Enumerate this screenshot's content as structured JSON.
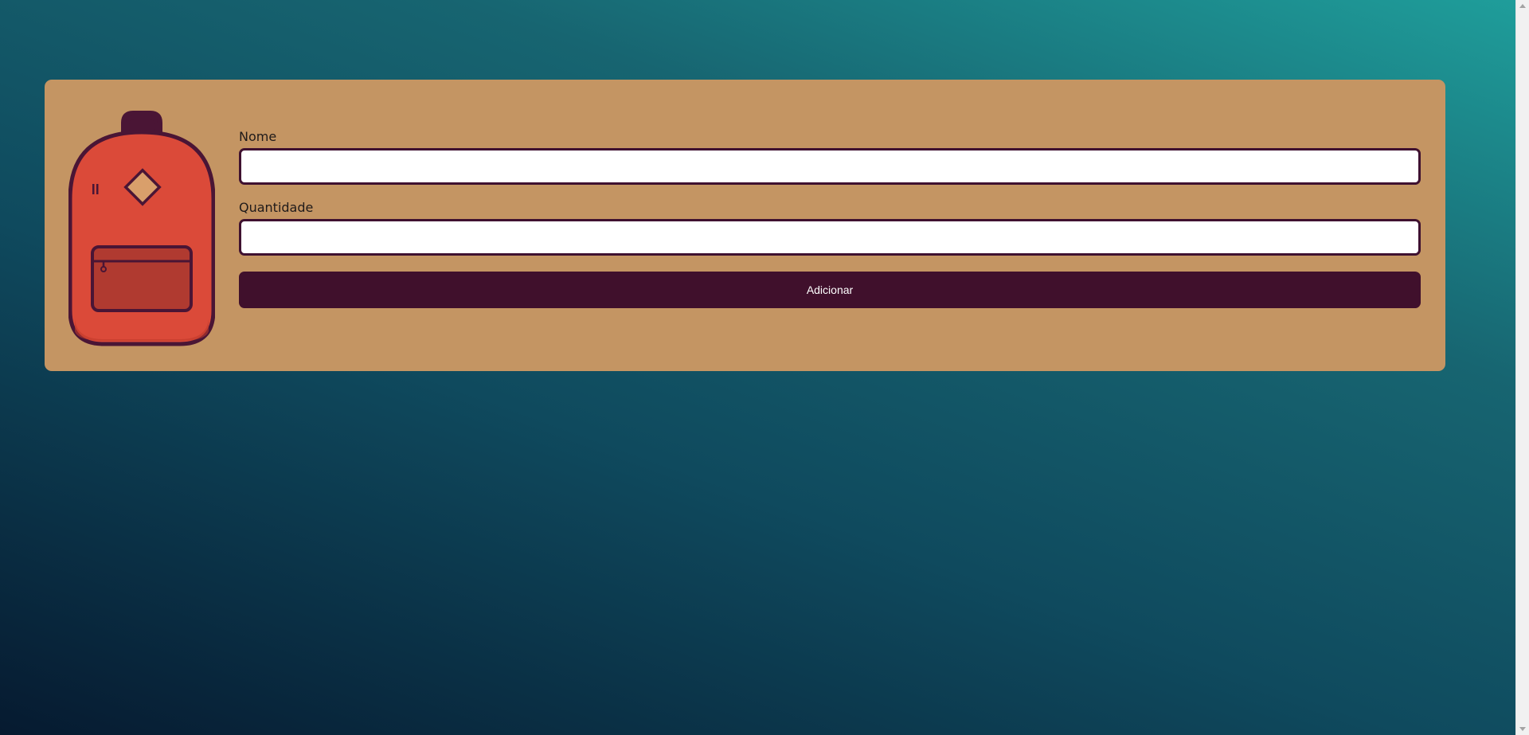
{
  "colors": {
    "card_background": "#c49563",
    "button_background": "#40102c",
    "input_border": "#3f1130",
    "backpack_body": "#db4a39",
    "backpack_outline": "#4a1535"
  },
  "illustration": {
    "icon": "backpack-icon"
  },
  "form": {
    "name_label": "Nome",
    "name_value": "",
    "quantity_label": "Quantidade",
    "quantity_value": "",
    "submit_label": "Adicionar"
  }
}
